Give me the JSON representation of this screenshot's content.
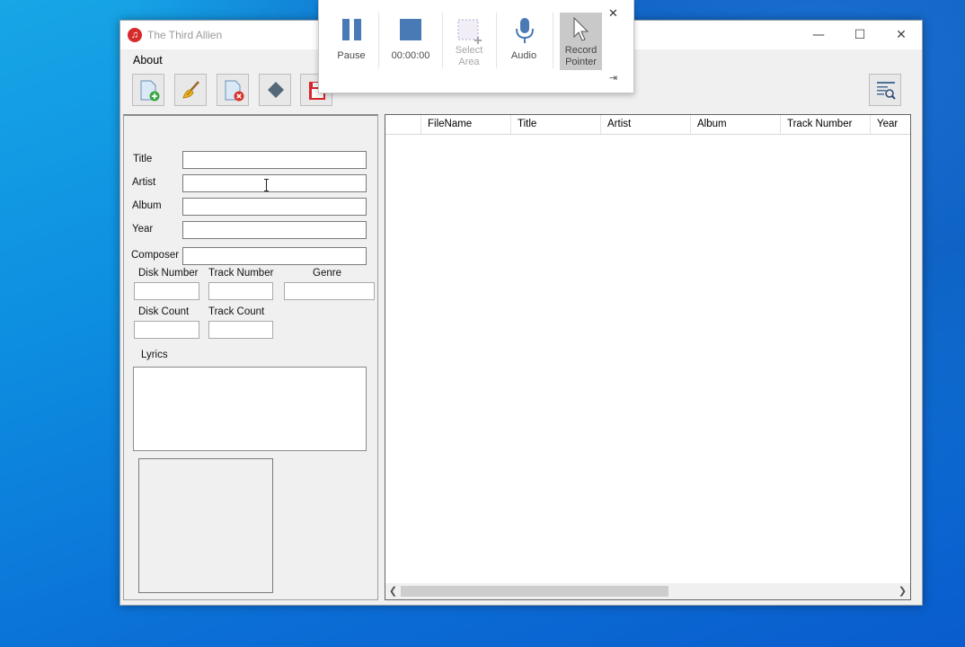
{
  "window": {
    "title": "The Third Allien",
    "minimize_glyph": "—",
    "maximize_glyph": "☐",
    "close_glyph": "✕"
  },
  "menu": {
    "about": "About"
  },
  "toolbar": {
    "buttons": [
      "add-file-icon",
      "clean-broom-icon",
      "remove-file-icon",
      "tag-diamond-icon",
      "save-icon"
    ],
    "search_icon": "search-list-icon"
  },
  "form": {
    "title_label": "Title",
    "artist_label": "Artist",
    "album_label": "Album",
    "year_label": "Year",
    "composer_label": "Composer",
    "disk_number_label": "Disk Number",
    "track_number_label": "Track Number",
    "genre_label": "Genre",
    "disk_count_label": "Disk Count",
    "track_count_label": "Track Count",
    "lyrics_label": "Lyrics",
    "title_value": "",
    "artist_value": "",
    "album_value": "",
    "year_value": "",
    "composer_value": ""
  },
  "list": {
    "columns": [
      "",
      "FileName",
      "Title",
      "Artist",
      "Album",
      "Track Number",
      "Year"
    ],
    "rows": []
  },
  "recorder": {
    "pause": "Pause",
    "timer": "00:00:00",
    "select_area_1": "Select",
    "select_area_2": "Area",
    "audio": "Audio",
    "record_pointer_1": "Record",
    "record_pointer_2": "Pointer",
    "close_glyph": "✕",
    "pin_glyph": "⇥"
  },
  "colors": {
    "accent": "#4a7ab5",
    "desktop": "#0d8ee0",
    "window_bg": "#f0f0f0"
  }
}
